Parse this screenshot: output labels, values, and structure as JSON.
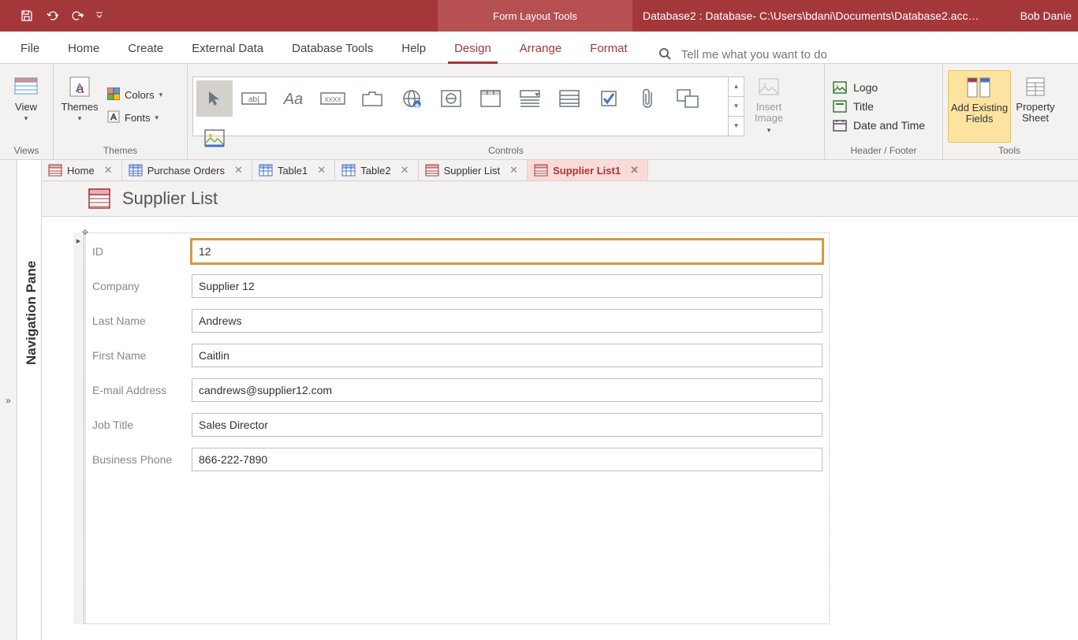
{
  "titleBar": {
    "contextTool": "Form Layout Tools",
    "fileTitle": "Database2 : Database- C:\\Users\\bdani\\Documents\\Database2.acc…",
    "userName": "Bob Danie"
  },
  "ribbonTabs": {
    "file": "File",
    "home": "Home",
    "create": "Create",
    "externalData": "External Data",
    "databaseTools": "Database Tools",
    "help": "Help",
    "design": "Design",
    "arrange": "Arrange",
    "format": "Format",
    "tellMe": "Tell me what you want to do"
  },
  "ribbonGroups": {
    "views": {
      "label": "Views",
      "view": "View"
    },
    "themes": {
      "label": "Themes",
      "themes": "Themes",
      "colors": "Colors",
      "fonts": "Fonts"
    },
    "controls": {
      "label": "Controls",
      "insertImage": "Insert\nImage"
    },
    "headerFooter": {
      "label": "Header / Footer",
      "logo": "Logo",
      "title": "Title",
      "dateTime": "Date and Time"
    },
    "tools": {
      "label": "Tools",
      "addExisting": "Add Existing\nFields",
      "propertySheet": "Property\nSheet"
    }
  },
  "docTabs": [
    {
      "label": "Home",
      "type": "form"
    },
    {
      "label": "Purchase Orders",
      "type": "table"
    },
    {
      "label": "Table1",
      "type": "table"
    },
    {
      "label": "Table2",
      "type": "table"
    },
    {
      "label": "Supplier List",
      "type": "form"
    },
    {
      "label": "Supplier List1",
      "type": "form",
      "active": true
    }
  ],
  "navPane": "Navigation Pane",
  "formHeader": "Supplier List",
  "formFields": [
    {
      "label": "ID",
      "value": "12",
      "selected": true
    },
    {
      "label": "Company",
      "value": "Supplier 12"
    },
    {
      "label": "Last Name",
      "value": "Andrews"
    },
    {
      "label": "First Name",
      "value": "Caitlin"
    },
    {
      "label": "E-mail Address",
      "value": "candrews@supplier12.com"
    },
    {
      "label": "Job Title",
      "value": "Sales Director"
    },
    {
      "label": "Business Phone",
      "value": "866-222-7890"
    }
  ]
}
